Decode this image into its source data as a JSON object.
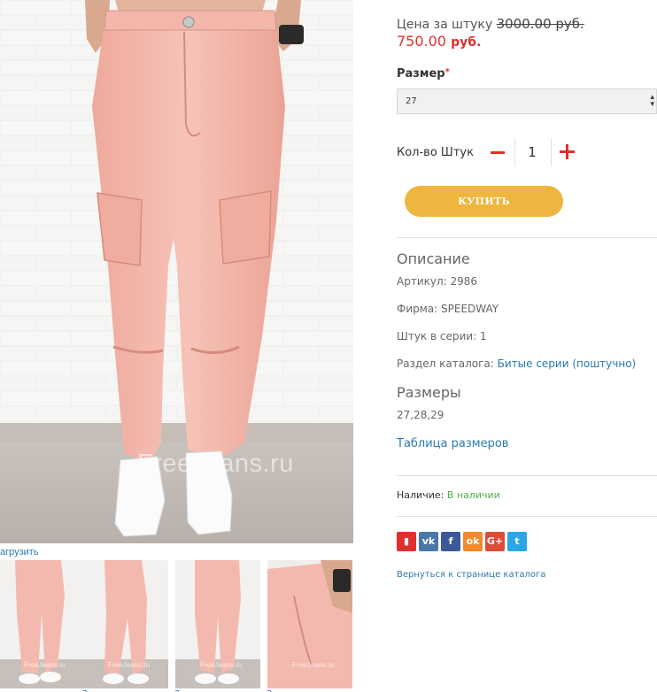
{
  "gallery": {
    "watermark": "FreeJeans.ru",
    "download_label": "агрузить",
    "thumbs": [
      {
        "watermark": "FreeJeans.ru",
        "link": "3"
      },
      {
        "watermark": "FreeJeans.ru",
        "link": "3"
      },
      {
        "watermark": "FreeJeans.ru",
        "link": "3"
      },
      {
        "watermark": "FreeJeans.ru",
        "link": "3"
      }
    ]
  },
  "price": {
    "label": "Цена за штуку",
    "old": "3000.00 руб.",
    "new_value": "750.00",
    "currency": "руб."
  },
  "size": {
    "label": "Размер",
    "required_mark": "*",
    "selected": "27",
    "arrow_up": "▴",
    "arrow_down": "▾"
  },
  "quantity": {
    "label": "Кол-во Штук",
    "value": "1"
  },
  "buy_button": "КУПИТЬ",
  "description": {
    "title": "Описание",
    "article_label": "Артикул:",
    "article": "2986",
    "brand_label": "Фирма:",
    "brand": "SPEEDWAY",
    "series_label": "Штук в серии:",
    "series": "1",
    "catalog_label": "Раздел каталога:",
    "catalog_link": "Битые серии (поштучно)"
  },
  "sizes": {
    "title": "Размеры",
    "values": "27,28,29",
    "table_link": "Таблица размеров"
  },
  "availability": {
    "label": "Наличие:",
    "status": "В наличии"
  },
  "share": [
    {
      "icon": "bookmark-icon",
      "glyph": "▮",
      "color": "#e0302d"
    },
    {
      "icon": "vk-icon",
      "glyph": "vk",
      "color": "#4a76a8"
    },
    {
      "icon": "facebook-icon",
      "glyph": "f",
      "color": "#3b5998"
    },
    {
      "icon": "odnoklassniki-icon",
      "glyph": "ok",
      "color": "#f2892b"
    },
    {
      "icon": "google-plus-icon",
      "glyph": "G+",
      "color": "#dd4b39"
    },
    {
      "icon": "twitter-icon",
      "glyph": "t",
      "color": "#2aa6e6"
    }
  ],
  "back_link": "Вернуться к странице каталога",
  "colors": {
    "price_red": "#e0302d",
    "buy_button": "#eeb63e",
    "link_blue": "#2a7ab0",
    "in_stock_green": "#4cb34a",
    "pants_pink": "#f4b9ae"
  }
}
